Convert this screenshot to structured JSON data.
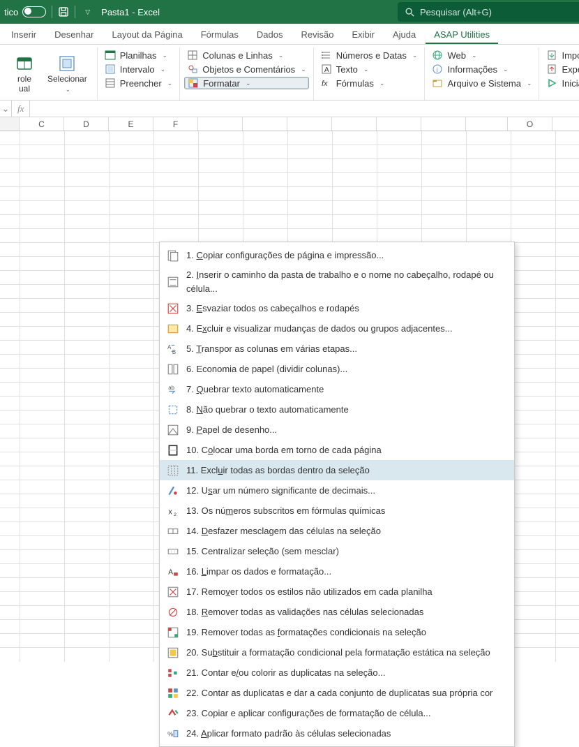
{
  "titlebar": {
    "autosave_label": "tico",
    "workbook_name": "Pasta1",
    "app_name": "Excel",
    "separator": "  -  "
  },
  "search": {
    "placeholder": "Pesquisar (Alt+G)"
  },
  "tabs": [
    "Inserir",
    "Desenhar",
    "Layout da Página",
    "Fórmulas",
    "Dados",
    "Revisão",
    "Exibir",
    "Ajuda",
    "ASAP Utilities"
  ],
  "tabs_active_index": 8,
  "ribbon": {
    "big": [
      {
        "line1": "role",
        "line2": "ual"
      },
      {
        "line1": "Selecionar",
        "line2": ""
      }
    ],
    "col1": [
      "Planilhas",
      "Intervalo",
      "Preencher"
    ],
    "col2": [
      "Colunas e Linhas",
      "Objetos e Comentários",
      "Formatar"
    ],
    "col3": [
      "Números e Datas",
      "Texto",
      "Fórmulas"
    ],
    "col4": [
      "Web",
      "Informações",
      "Arquivo e Sistema"
    ],
    "col5": [
      "Importar",
      "Exportar",
      "Iniciar"
    ]
  },
  "menu": {
    "items": [
      {
        "n": "1.",
        "t": "Copiar configurações de página e impressão...",
        "u": "C"
      },
      {
        "n": "2.",
        "t": "Inserir o caminho da pasta de trabalho e o nome no cabeçalho, rodapé ou célula...",
        "u": "I"
      },
      {
        "n": "3.",
        "t": "Esvaziar todos os cabeçalhos e rodapés",
        "u": "E"
      },
      {
        "n": "4.",
        "t": "Excluir e visualizar mudanças de dados ou grupos adjacentes...",
        "u": "x"
      },
      {
        "n": "5.",
        "t": "Transpor as colunas em várias etapas...",
        "u": "T"
      },
      {
        "n": "6.",
        "t": "Economia de papel (dividir colunas)...",
        "u": ""
      },
      {
        "n": "7.",
        "t": "Quebrar texto automaticamente",
        "u": "Q"
      },
      {
        "n": "8.",
        "t": "Não quebrar o texto automaticamente",
        "u": "N"
      },
      {
        "n": "9.",
        "t": "Papel de desenho...",
        "u": "P"
      },
      {
        "n": "10.",
        "t": "Colocar uma borda em torno de cada página",
        "u": "o"
      },
      {
        "n": "11.",
        "t": "Excluir todas as bordas dentro da seleção",
        "u": "u",
        "hover": true
      },
      {
        "n": "12.",
        "t": "Usar um número significante de decimais...",
        "u": "s"
      },
      {
        "n": "13.",
        "t": "Os números subscritos em fórmulas químicas",
        "u": "m"
      },
      {
        "n": "14.",
        "t": "Desfazer mesclagem das células na seleção",
        "u": "D"
      },
      {
        "n": "15.",
        "t": "Centralizar seleção (sem mesclar)",
        "u": ""
      },
      {
        "n": "16.",
        "t": "Limpar os dados e formatação...",
        "u": "L"
      },
      {
        "n": "17.",
        "t": "Remover todos os estilos não utilizados em cada planilha",
        "u": "v"
      },
      {
        "n": "18.",
        "t": "Remover todas as validações nas células selecionadas",
        "u": "R"
      },
      {
        "n": "19.",
        "t": "Remover todas as formatações condicionais na seleção",
        "u": "f"
      },
      {
        "n": "20.",
        "t": "Substituir a formatação condicional pela formatação estática na seleção",
        "u": "b"
      },
      {
        "n": "21.",
        "t": "Contar e/ou colorir as duplicatas na seleção...",
        "u": "/"
      },
      {
        "n": "22.",
        "t": "Contar as duplicatas e dar a cada conjunto de duplicatas sua própria cor",
        "u": ""
      },
      {
        "n": "23.",
        "t": "Copiar e aplicar configurações de formatação de célula...",
        "u": ""
      },
      {
        "n": "24.",
        "t": "Aplicar formato padrão às células selecionadas",
        "u": "A"
      }
    ]
  },
  "columns": [
    "",
    "C",
    "D",
    "E",
    "F",
    "",
    "",
    "",
    "",
    "",
    "",
    "",
    "O"
  ],
  "icons": {
    "save": "save-icon",
    "dropdown": "chevron-down-icon",
    "gear": "gear-icon",
    "search": "search-icon",
    "refresh": "refresh-icon",
    "play": "play-icon"
  },
  "colors": {
    "brand": "#217346",
    "menu_hover": "#d9e7ef"
  }
}
